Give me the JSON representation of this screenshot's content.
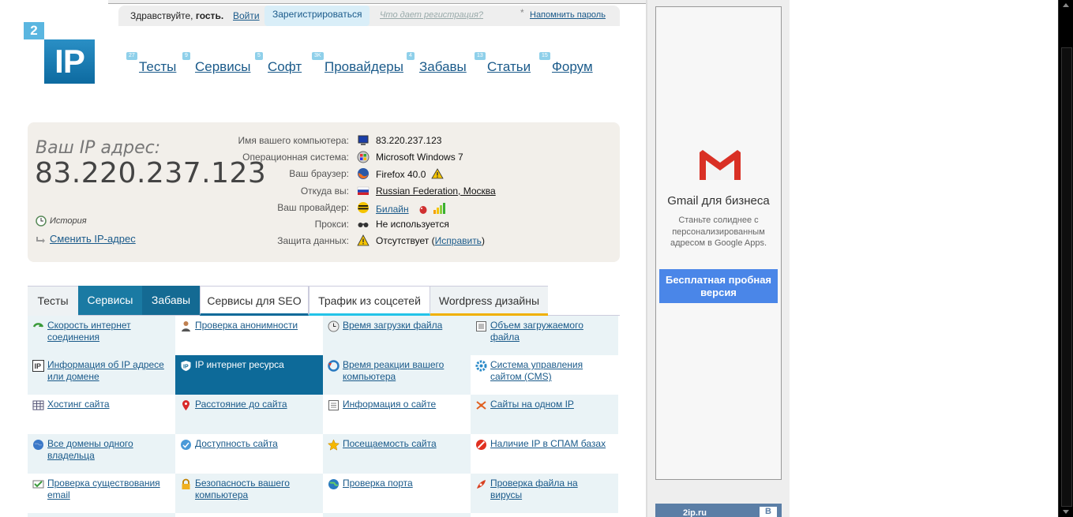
{
  "topbar": {
    "greeting_prefix": "Здравствуйте,",
    "greeting_name": "гость.",
    "login": "Войти",
    "register": "Зарегистрироваться",
    "why_register": "Что дает регистрация?",
    "star": "*",
    "remind_password": "Напомнить пароль"
  },
  "logo": {
    "small": "2",
    "big": "IP"
  },
  "nav": [
    {
      "count": "27",
      "label": "Тесты"
    },
    {
      "count": "9",
      "label": "Сервисы"
    },
    {
      "count": "5",
      "label": "Софт"
    },
    {
      "count": "3K",
      "label": "Провайдеры"
    },
    {
      "count": "4",
      "label": "Забавы"
    },
    {
      "count": "13",
      "label": "Статьи"
    },
    {
      "count": "15",
      "label": "Форум"
    }
  ],
  "ip_panel": {
    "label": "Ваш IP адрес:",
    "ip": "83.220.237.123",
    "history": "История",
    "change_ip": "Сменить IP-адрес",
    "rows": [
      {
        "key": "Имя вашего компьютера:",
        "value": "83.220.237.123",
        "icon": "computer-icon"
      },
      {
        "key": "Операционная система:",
        "value": "Microsoft Windows 7",
        "icon": "windows-icon"
      },
      {
        "key": "Ваш браузер:",
        "value": "Firefox 40.0",
        "icon": "firefox-icon"
      },
      {
        "key": "Откуда вы:",
        "value": "Russian Federation, Москва",
        "icon": "russia-flag-icon"
      },
      {
        "key": "Ваш провайдер:",
        "value": "Билайн",
        "icon": "beeline-icon"
      },
      {
        "key": "Прокси:",
        "value": "Не используется",
        "icon": "glasses-icon"
      },
      {
        "key": "Защита данных:",
        "value_prefix": "Отсутствует (",
        "value_link": "Исправить",
        "value_suffix": ")",
        "icon": "warning-icon"
      }
    ]
  },
  "tabs": [
    {
      "label": "Тесты"
    },
    {
      "label": "Сервисы"
    },
    {
      "label": "Забавы"
    },
    {
      "label": "Сервисы для SEO"
    },
    {
      "label": "Трафик из соцсетей"
    },
    {
      "label": "Wordpress дизайны"
    }
  ],
  "services": [
    [
      "Скорость интернет соединения",
      "Проверка анонимности",
      "Время загрузки файла",
      "Объем загружаемого файла"
    ],
    [
      "Информация об IP адресе или домене",
      "IP интернет ресурса",
      "Время реакции вашего компьютера",
      "Система управления сайтом (CMS)"
    ],
    [
      "Хостинг сайта",
      "Расстояние до сайта",
      "Информация о сайте",
      "Сайты на одном IP"
    ],
    [
      "Все домены одного владельца",
      "Доступность сайта",
      "Посещаемость сайта",
      "Наличие IP в СПАМ базах"
    ],
    [
      "Проверка существования email",
      "Безопасность вашего компьютера",
      "Проверка порта",
      "Проверка файла на вирусы"
    ]
  ],
  "ad": {
    "title": "Gmail для бизнеса",
    "desc": "Станьте солиднее с персонализированным адресом в Google Apps.",
    "button": "Бесплатная пробная версия"
  },
  "bottom_ad": {
    "text": "2ip.ru",
    "badge": "B"
  }
}
